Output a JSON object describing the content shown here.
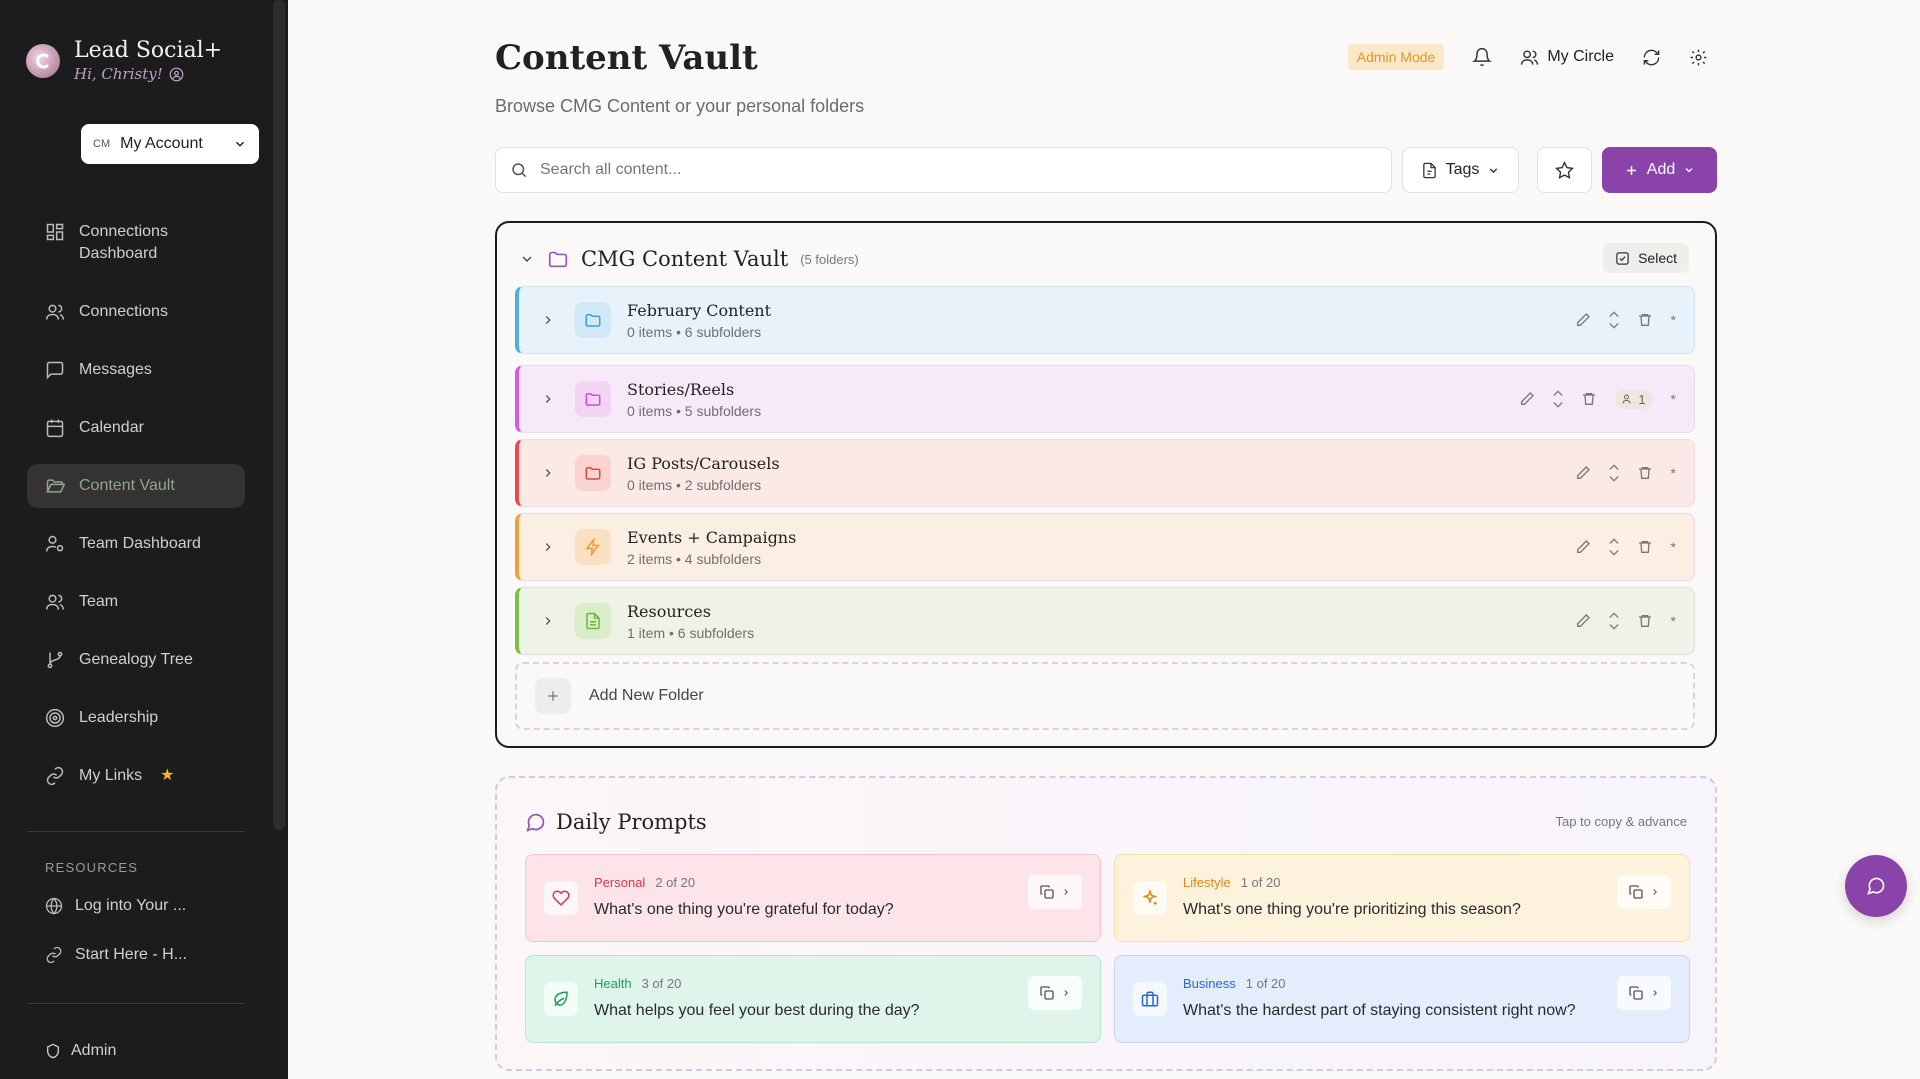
{
  "brand": {
    "title": "Lead Social+",
    "greeting": "Hi, Christy!"
  },
  "account": {
    "initials": "CM",
    "label": "My Account"
  },
  "nav": [
    {
      "label": "Connections Dashboard",
      "icon": "dashboard-icon"
    },
    {
      "label": "Connections",
      "icon": "users-icon"
    },
    {
      "label": "Messages",
      "icon": "message-icon"
    },
    {
      "label": "Calendar",
      "icon": "calendar-icon"
    },
    {
      "label": "Content Vault",
      "icon": "folder-open-icon",
      "active": true
    },
    {
      "label": "Team Dashboard",
      "icon": "user-cog-icon"
    },
    {
      "label": "Team",
      "icon": "users-icon"
    },
    {
      "label": "Genealogy Tree",
      "icon": "git-branch-icon"
    },
    {
      "label": "Leadership",
      "icon": "target-icon"
    },
    {
      "label": "My Links",
      "icon": "link-icon",
      "starred": true
    }
  ],
  "resources": {
    "heading": "RESOURCES",
    "items": [
      {
        "label": "Log into Your ...",
        "icon": "globe-icon"
      },
      {
        "label": "Start Here - H...",
        "icon": "link-icon"
      }
    ]
  },
  "admin_link": "Admin",
  "header": {
    "title": "Content Vault",
    "subtitle": "Browse CMG Content or your personal folders",
    "admin_badge": "Admin Mode",
    "circle_label": "My Circle"
  },
  "search": {
    "placeholder": "Search all content..."
  },
  "toolbar": {
    "tags_label": "Tags",
    "add_label": "Add"
  },
  "vault": {
    "title": "CMG Content Vault",
    "count": "(5 folders)",
    "select_label": "Select",
    "add_folder_label": "Add New Folder",
    "folders": [
      {
        "name": "February Content",
        "meta": "0 items • 6 subfolders",
        "accent": "#4fb0e6",
        "bg": "#e8f2fa",
        "icon_color": "#3a9fdc",
        "icon_bg": "#d2e8f7",
        "icon": "folder-icon"
      },
      {
        "name": "Stories/Reels",
        "meta": "0 items • 5 subfolders",
        "accent": "#d35ce0",
        "bg": "#f8e9f8",
        "icon_color": "#cc4fd9",
        "icon_bg": "#f2d4f4",
        "icon": "folder-icon",
        "shared": "1"
      },
      {
        "name": "IG Posts/Carousels",
        "meta": "0 items • 2 subfolders",
        "accent": "#e84a4a",
        "bg": "#fbe9e6",
        "icon_color": "#e04848",
        "icon_bg": "#f8d3cf",
        "icon": "folder-icon"
      },
      {
        "name": "Events + Campaigns",
        "meta": "2 items • 4 subfolders",
        "accent": "#f0a03a",
        "bg": "#fbefe3",
        "icon_color": "#ef9a2e",
        "icon_bg": "#f8e0c0",
        "icon": "zap-icon"
      },
      {
        "name": "Resources",
        "meta": "1 item • 6 subfolders",
        "accent": "#7cc242",
        "bg": "#eff3e6",
        "icon_color": "#6db83a",
        "icon_bg": "#dbecc8",
        "icon": "file-text-icon"
      }
    ]
  },
  "prompts": {
    "title": "Daily Prompts",
    "hint": "Tap to copy & advance",
    "cards": [
      {
        "category": "Personal",
        "position": "2 of 20",
        "text": "What's one thing you're grateful for today?",
        "color": "#d8364f",
        "bg": "#fde4e8",
        "border": "#f6c2cb",
        "icon": "heart-icon"
      },
      {
        "category": "Lifestyle",
        "position": "1 of 20",
        "text": "What's one thing you're prioritizing this season?",
        "color": "#d98a17",
        "bg": "#fdf3dd",
        "border": "#f5dea8",
        "icon": "sparkles-icon"
      },
      {
        "category": "Health",
        "position": "3 of 20",
        "text": "What helps you feel your best during the day?",
        "color": "#1f9c5b",
        "bg": "#dff5ea",
        "border": "#b9e5cd",
        "icon": "leaf-icon"
      },
      {
        "category": "Business",
        "position": "1 of 20",
        "text": "What's the hardest part of staying consistent right now?",
        "color": "#2e63d8",
        "bg": "#e3edfb",
        "border": "#c3d6f4",
        "icon": "briefcase-icon"
      }
    ]
  }
}
